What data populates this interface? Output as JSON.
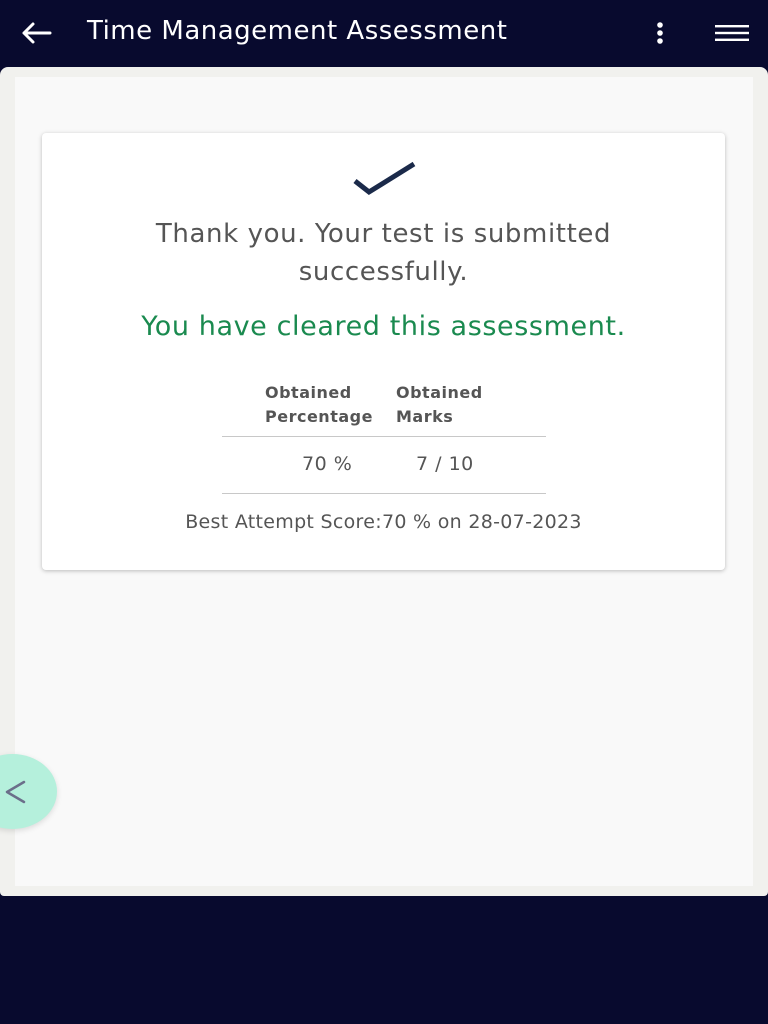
{
  "app_bar": {
    "title": "Time Management Assessment",
    "back_icon": "arrow-left-icon",
    "more_icon": "more-vertical-icon",
    "menu_icon": "hamburger-menu-icon"
  },
  "result_card": {
    "status_icon": "checkmark-icon",
    "thanks_line1": "Thank you. Your test is submitted",
    "thanks_line2": "successfully.",
    "cleared_message": "You have cleared this assessment.",
    "table": {
      "headers": {
        "percentage_line1": "Obtained",
        "percentage_line2": "Percentage",
        "marks_line1": "Obtained",
        "marks_line2": "Marks"
      },
      "row": {
        "percentage": "70 %",
        "marks": "7 / 10"
      }
    },
    "best_attempt": "Best Attempt Score:70 % on 28-07-2023"
  },
  "side_toggle": {
    "icon": "chevron-left-icon"
  },
  "colors": {
    "app_bar_bg": "#080a2e",
    "success_green": "#1a8a4f",
    "check_navy": "#1b2a4a",
    "toggle_mint": "#b5f0dc",
    "text_gray": "#555555"
  }
}
